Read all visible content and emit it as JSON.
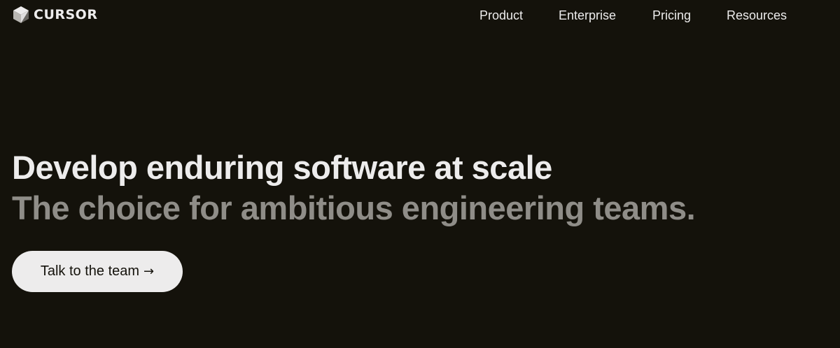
{
  "header": {
    "brand": {
      "icon": "cube-logo-icon",
      "name": "CURSOR"
    },
    "nav": [
      {
        "label": "Product"
      },
      {
        "label": "Enterprise"
      },
      {
        "label": "Pricing"
      },
      {
        "label": "Resources"
      }
    ]
  },
  "hero": {
    "title": "Develop enduring software at scale",
    "subtitle": "The choice for ambitious engineering teams.",
    "cta": {
      "label": "Talk to the team",
      "arrow": "→",
      "icon": "arrow-right-icon"
    }
  },
  "colors": {
    "background": "#14120b",
    "text": "#edecec",
    "muted_text": "#8f8d88",
    "button_bg": "#edecec",
    "button_text": "#14120b"
  }
}
